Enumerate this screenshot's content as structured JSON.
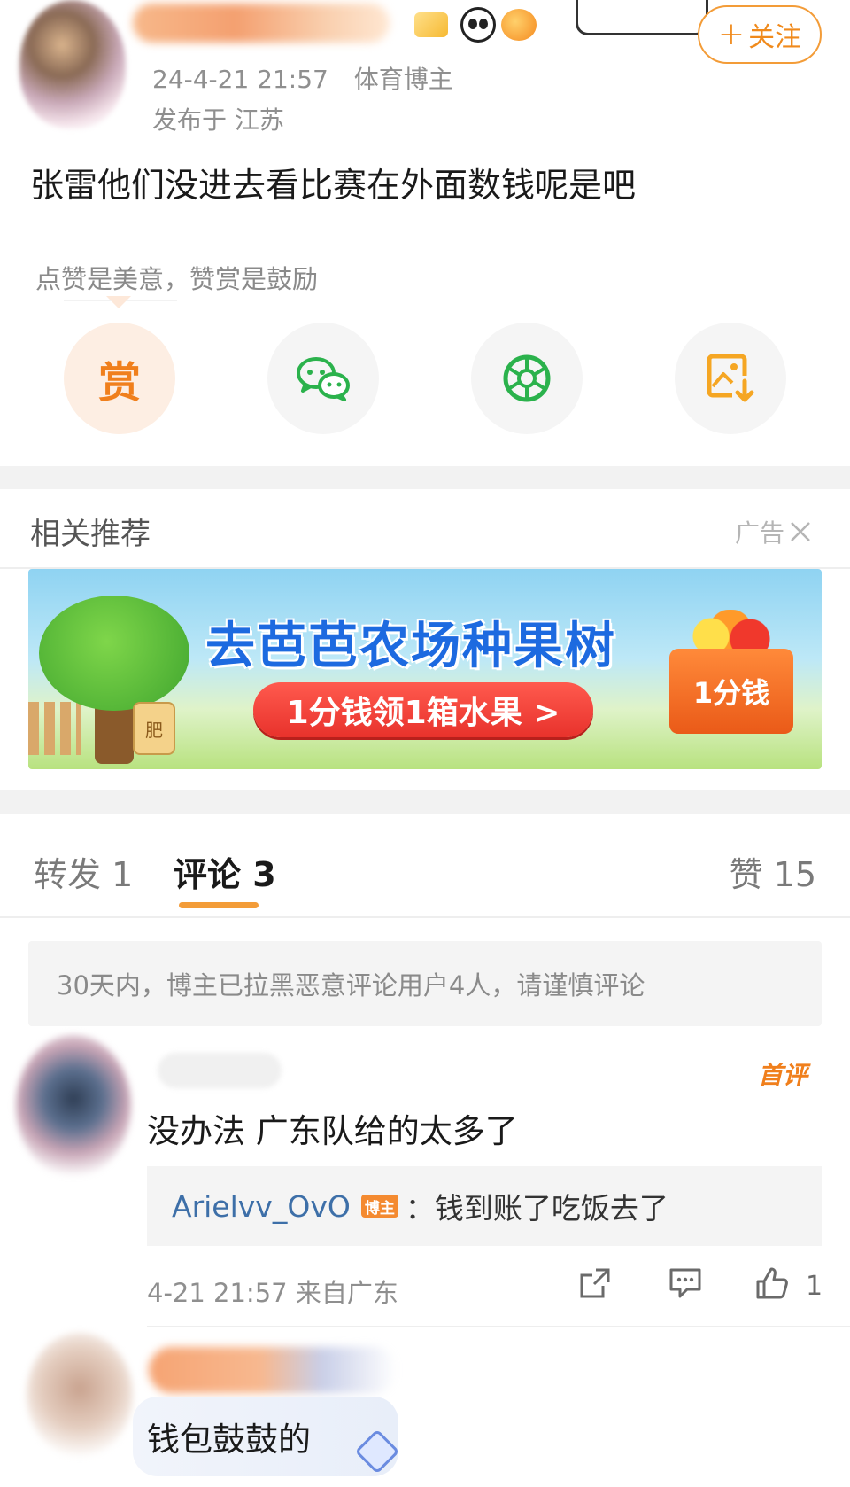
{
  "post": {
    "timestamp": "24-4-21 21:57",
    "author_tag": "体育博主",
    "location": "发布于 江苏",
    "follow_label": "关注",
    "text": "张雷他们没进去看比赛在外面数钱呢是吧"
  },
  "reward": {
    "hint": "点赞是美意，赞赏是鼓励",
    "reward_glyph": "赏"
  },
  "share_actions": [
    {
      "icon": "reward-icon",
      "color": "#f07f1c"
    },
    {
      "icon": "wechat-icon",
      "color": "#2bb24c"
    },
    {
      "icon": "moments-icon",
      "color": "#2bb24c"
    },
    {
      "icon": "save-image-icon",
      "color": "#f5a623"
    }
  ],
  "recommend": {
    "title": "相关推荐",
    "ad_label": "广告",
    "ad": {
      "headline": "去芭芭农场种果树",
      "cta": "1分钱领1箱水果 >",
      "box_label": "1分钱",
      "bag_label": "肥"
    }
  },
  "tabs": {
    "repost": "转发 1",
    "comments": "评论 3",
    "likes": "赞 15"
  },
  "notice": "30天内，博主已拉黑恶意评论用户4人，请谨慎评论",
  "comments": [
    {
      "first_tag": "首评",
      "text": "没办法 广东队给的太多了",
      "reply": {
        "user": "Arielvv_OvO",
        "badge": "博主",
        "text": "：钱到账了吃饭去了"
      },
      "meta": "4-21 21:57  来自广东",
      "like_count": "1"
    },
    {
      "text": "钱包鼓鼓的"
    }
  ],
  "colors": {
    "accent": "#f39c38",
    "link": "#3d6fa8",
    "muted": "#8f8f8f"
  }
}
